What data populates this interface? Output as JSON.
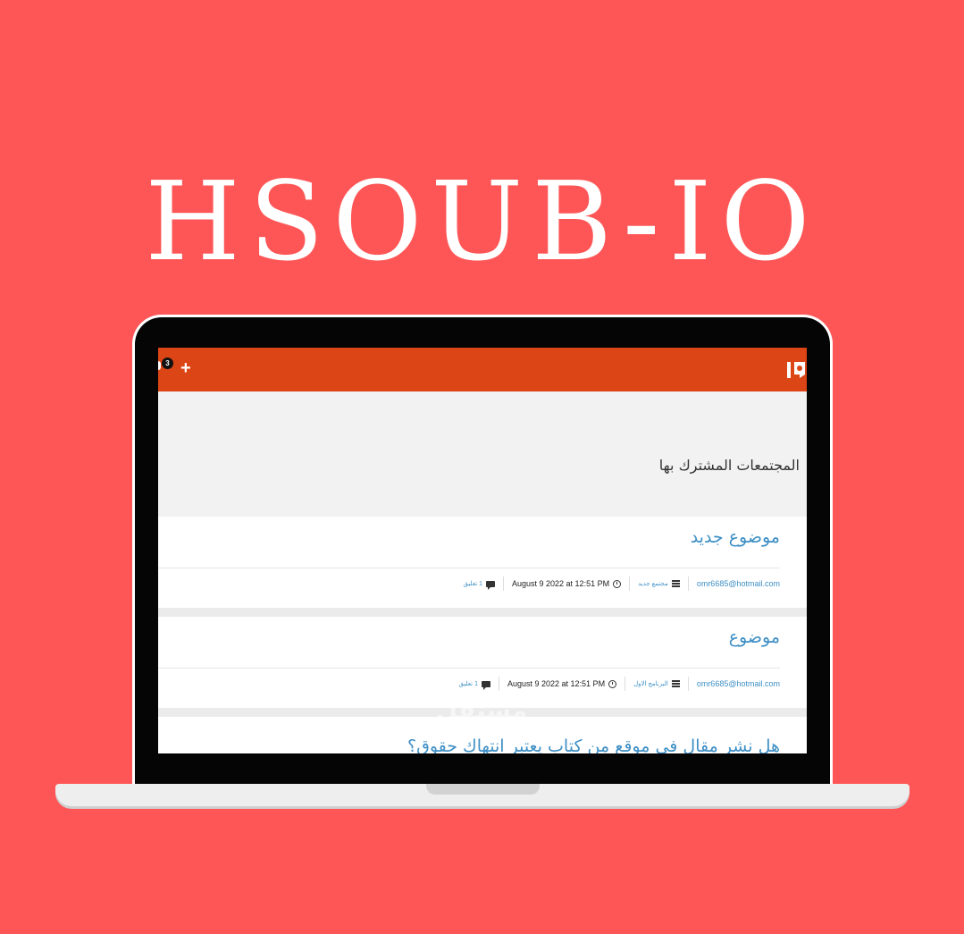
{
  "hero": {
    "title": "HSOUB-IO"
  },
  "topbar": {
    "notification_count": "3",
    "add_label": "+",
    "logo_icon": "io-logo-icon",
    "color": "#dc4516"
  },
  "page": {
    "heading": "المجتمعات المشترك بها"
  },
  "posts": [
    {
      "title": "موضوع جديد",
      "author": "omr6685@hotmail.com",
      "community": "مجتمع جديد",
      "date": "August 9 2022 at 12:51 PM",
      "comments": "1 تعليق"
    },
    {
      "title": "موضوع",
      "author": "omr6685@hotmail.com",
      "community": "البرنامج الاول",
      "date": "August 9 2022 at 12:51 PM",
      "comments": "1 تعليق"
    },
    {
      "title": "هل نشر مقال في موقع من كتاب يعتبر انتهاك حقوق؟"
    }
  ],
  "watermark": {
    "arabic": "مستقل",
    "latin": "mostaql.com"
  },
  "colors": {
    "background": "#fe5656",
    "link": "#3e8fc5",
    "header_band": "#f2f2f2"
  }
}
